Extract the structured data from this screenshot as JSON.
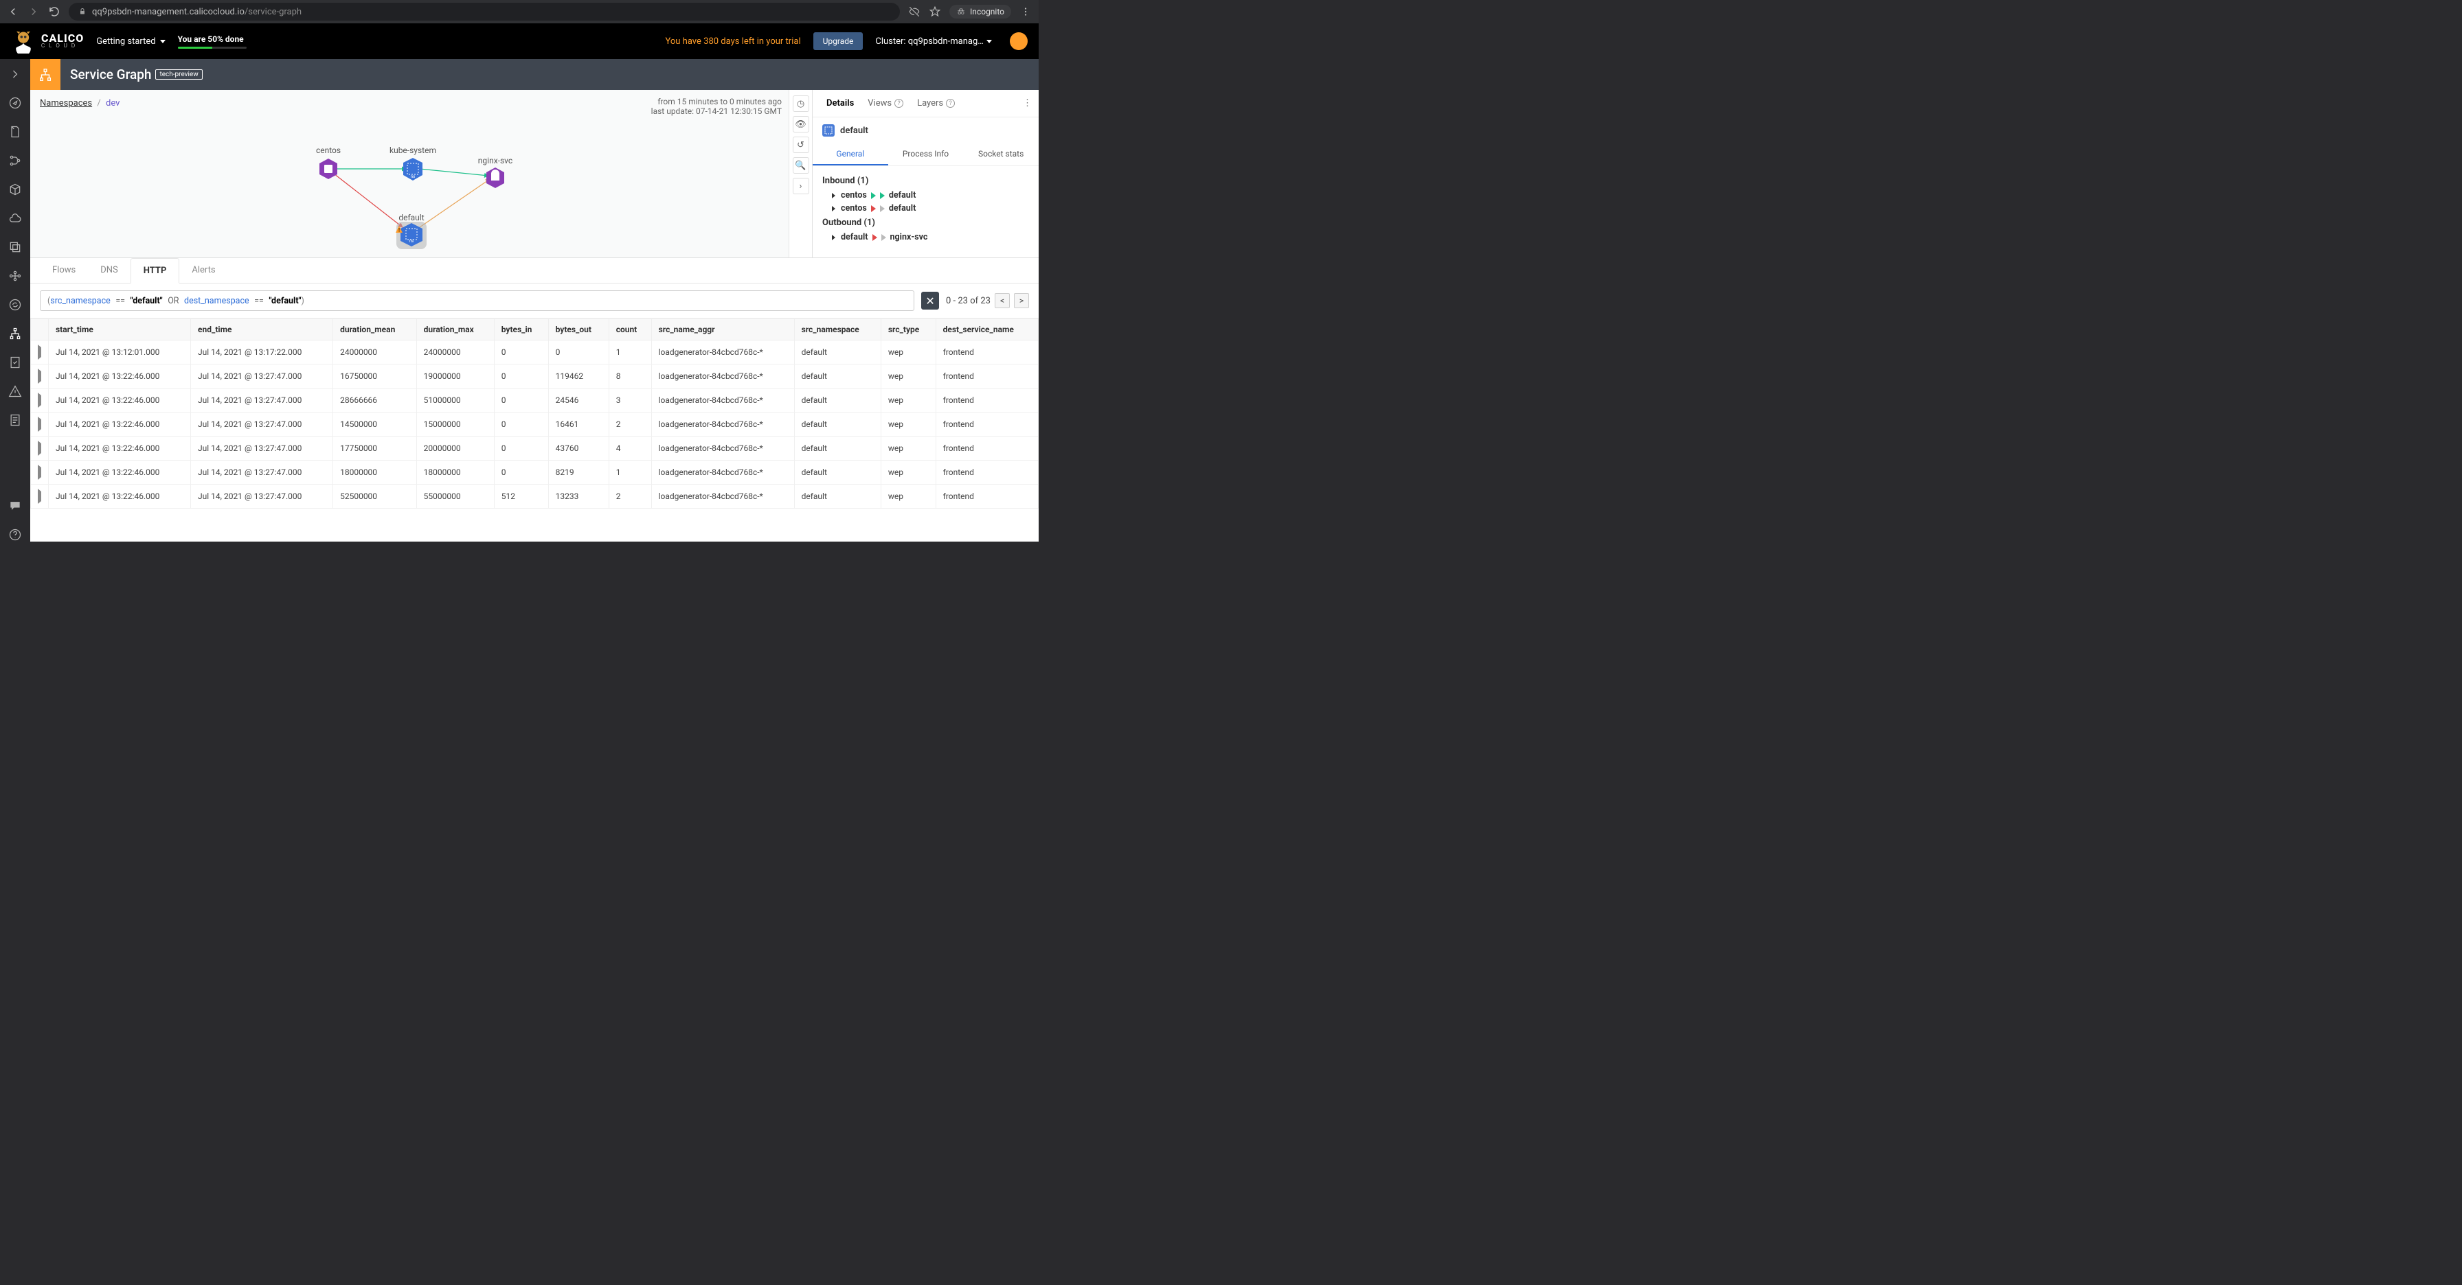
{
  "browser": {
    "url_host": "qq9psbdn-management.calicocloud.io",
    "url_path": "/service-graph",
    "incognito": "Incognito"
  },
  "topbar": {
    "logo_top": "CALICO",
    "logo_sub": "C L O U D",
    "getting_started": "Getting started",
    "progress_text": "You are 50% done",
    "trial": "You have 380 days left in your trial",
    "upgrade": "Upgrade",
    "cluster": "Cluster: qq9psbdn-manag…"
  },
  "page": {
    "title": "Service Graph",
    "chip": "tech-preview",
    "crumb_root": "Namespaces",
    "crumb_current": "dev",
    "time_range": "from 15 minutes to 0 minutes ago",
    "last_update": "last update: 07-14-21 12:30:15 GMT"
  },
  "graph_nodes": {
    "centos": "centos",
    "kube_system": "kube-system",
    "nginx_svc": "nginx-svc",
    "default": "default"
  },
  "details": {
    "tabs": {
      "details": "Details",
      "views": "Views",
      "layers": "Layers"
    },
    "title": "default",
    "subtabs": {
      "general": "General",
      "process": "Process Info",
      "socket": "Socket stats"
    },
    "inbound_hdr": "Inbound (1)",
    "outbound_hdr": "Outbound (1)",
    "rows": {
      "in1_src": "centos",
      "in1_dst": "default",
      "in2_src": "centos",
      "in2_dst": "default",
      "out1_src": "default",
      "out1_dst": "nginx-svc"
    }
  },
  "bottom": {
    "tabs": {
      "flows": "Flows",
      "dns": "DNS",
      "http": "HTTP",
      "alerts": "Alerts"
    },
    "filter": {
      "src": "src_namespace",
      "or": "OR",
      "dst": "dest_namespace",
      "eq": "==",
      "val": "\"default\""
    },
    "pager": "0 - 23 of 23",
    "columns": [
      "start_time",
      "end_time",
      "duration_mean",
      "duration_max",
      "bytes_in",
      "bytes_out",
      "count",
      "src_name_aggr",
      "src_namespace",
      "src_type",
      "dest_service_name"
    ],
    "rows": [
      [
        "Jul 14, 2021 @ 13:12:01.000",
        "Jul 14, 2021 @ 13:17:22.000",
        "24000000",
        "24000000",
        "0",
        "0",
        "1",
        "loadgenerator-84cbcd768c-*",
        "default",
        "wep",
        "frontend"
      ],
      [
        "Jul 14, 2021 @ 13:22:46.000",
        "Jul 14, 2021 @ 13:27:47.000",
        "16750000",
        "19000000",
        "0",
        "119462",
        "8",
        "loadgenerator-84cbcd768c-*",
        "default",
        "wep",
        "frontend"
      ],
      [
        "Jul 14, 2021 @ 13:22:46.000",
        "Jul 14, 2021 @ 13:27:47.000",
        "28666666",
        "51000000",
        "0",
        "24546",
        "3",
        "loadgenerator-84cbcd768c-*",
        "default",
        "wep",
        "frontend"
      ],
      [
        "Jul 14, 2021 @ 13:22:46.000",
        "Jul 14, 2021 @ 13:27:47.000",
        "14500000",
        "15000000",
        "0",
        "16461",
        "2",
        "loadgenerator-84cbcd768c-*",
        "default",
        "wep",
        "frontend"
      ],
      [
        "Jul 14, 2021 @ 13:22:46.000",
        "Jul 14, 2021 @ 13:27:47.000",
        "17750000",
        "20000000",
        "0",
        "43760",
        "4",
        "loadgenerator-84cbcd768c-*",
        "default",
        "wep",
        "frontend"
      ],
      [
        "Jul 14, 2021 @ 13:22:46.000",
        "Jul 14, 2021 @ 13:27:47.000",
        "18000000",
        "18000000",
        "0",
        "8219",
        "1",
        "loadgenerator-84cbcd768c-*",
        "default",
        "wep",
        "frontend"
      ],
      [
        "Jul 14, 2021 @ 13:22:46.000",
        "Jul 14, 2021 @ 13:27:47.000",
        "52500000",
        "55000000",
        "512",
        "13233",
        "2",
        "loadgenerator-84cbcd768c-*",
        "default",
        "wep",
        "frontend"
      ]
    ]
  }
}
